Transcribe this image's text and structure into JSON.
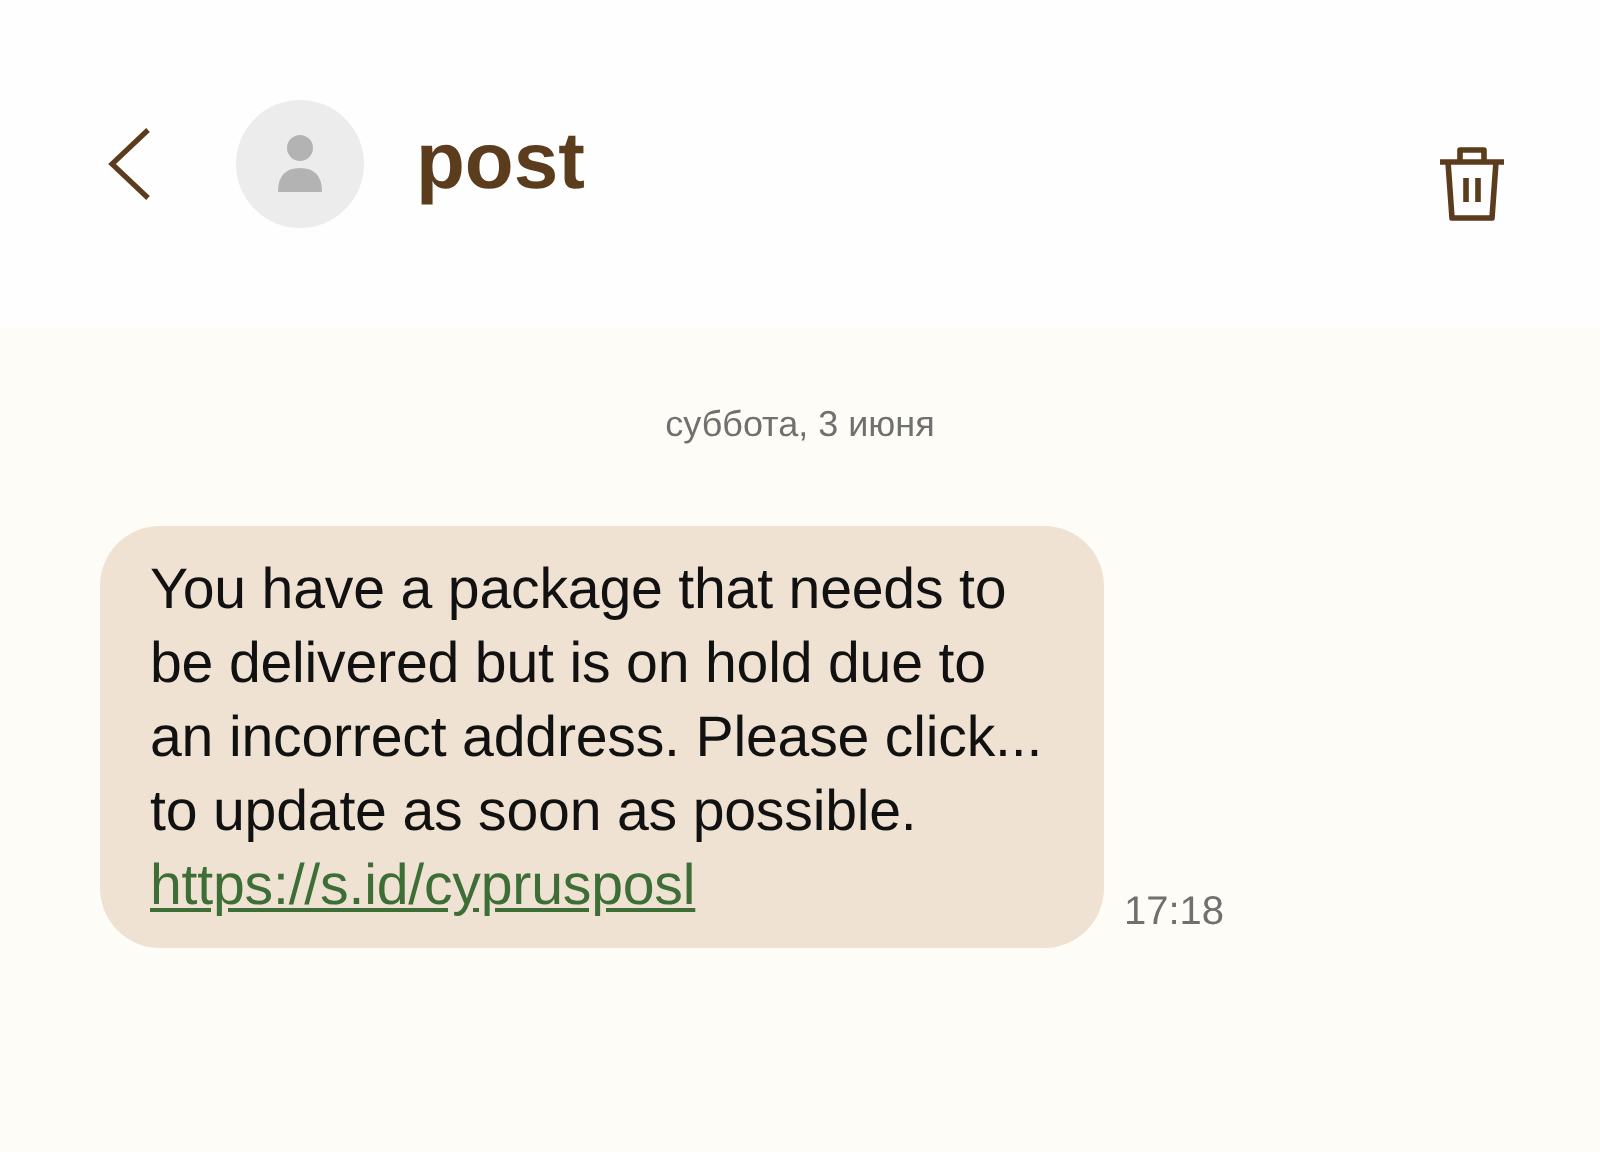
{
  "header": {
    "contact": "post"
  },
  "date_separator": "суббота, 3 июня",
  "messages": [
    {
      "text": "You have a package that needs to be delivered but is on hold due to an incorrect address. Please click... to update as soon as possible.",
      "link": "https://s.id/cyprusposl",
      "time": "17:18"
    }
  ]
}
